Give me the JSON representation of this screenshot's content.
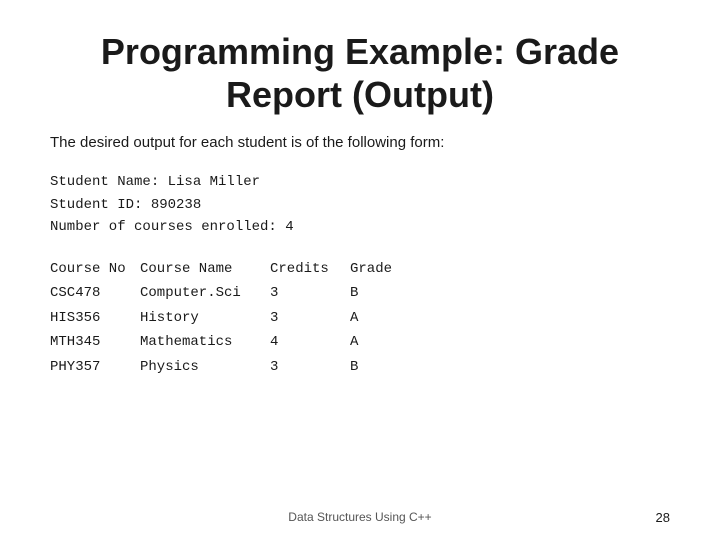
{
  "title": {
    "line1": "Programming Example: Grade",
    "line2": "Report (Output)"
  },
  "subtitle": "The desired output for each student is of the following form:",
  "code": {
    "line1": "Student Name: Lisa Miller",
    "line2": "Student ID: 890238",
    "line3": "Number of courses enrolled: 4"
  },
  "table": {
    "headers": {
      "col1": "Course No",
      "col2": "Course Name",
      "col3": "Credits",
      "col4": "Grade"
    },
    "rows": [
      {
        "no": "CSC478",
        "name": "Computer.Sci",
        "credits": "3",
        "grade": "B"
      },
      {
        "no": "HIS356",
        "name": "History",
        "credits": "3",
        "grade": "A"
      },
      {
        "no": "MTH345",
        "name": "Mathematics",
        "credits": "4",
        "grade": "A"
      },
      {
        "no": "PHY357",
        "name": "Physics",
        "credits": "3",
        "grade": "B"
      }
    ]
  },
  "footer": {
    "text": "Data Structures Using C++",
    "page": "28"
  }
}
